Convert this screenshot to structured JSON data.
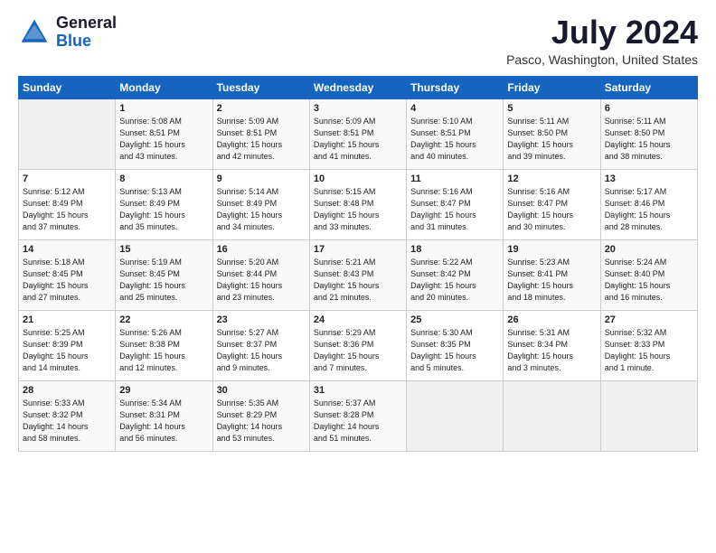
{
  "header": {
    "logo_general": "General",
    "logo_blue": "Blue",
    "month_year": "July 2024",
    "location": "Pasco, Washington, United States"
  },
  "days_of_week": [
    "Sunday",
    "Monday",
    "Tuesday",
    "Wednesday",
    "Thursday",
    "Friday",
    "Saturday"
  ],
  "weeks": [
    [
      {
        "day": "",
        "info": ""
      },
      {
        "day": "1",
        "info": "Sunrise: 5:08 AM\nSunset: 8:51 PM\nDaylight: 15 hours\nand 43 minutes."
      },
      {
        "day": "2",
        "info": "Sunrise: 5:09 AM\nSunset: 8:51 PM\nDaylight: 15 hours\nand 42 minutes."
      },
      {
        "day": "3",
        "info": "Sunrise: 5:09 AM\nSunset: 8:51 PM\nDaylight: 15 hours\nand 41 minutes."
      },
      {
        "day": "4",
        "info": "Sunrise: 5:10 AM\nSunset: 8:51 PM\nDaylight: 15 hours\nand 40 minutes."
      },
      {
        "day": "5",
        "info": "Sunrise: 5:11 AM\nSunset: 8:50 PM\nDaylight: 15 hours\nand 39 minutes."
      },
      {
        "day": "6",
        "info": "Sunrise: 5:11 AM\nSunset: 8:50 PM\nDaylight: 15 hours\nand 38 minutes."
      }
    ],
    [
      {
        "day": "7",
        "info": "Sunrise: 5:12 AM\nSunset: 8:49 PM\nDaylight: 15 hours\nand 37 minutes."
      },
      {
        "day": "8",
        "info": "Sunrise: 5:13 AM\nSunset: 8:49 PM\nDaylight: 15 hours\nand 35 minutes."
      },
      {
        "day": "9",
        "info": "Sunrise: 5:14 AM\nSunset: 8:49 PM\nDaylight: 15 hours\nand 34 minutes."
      },
      {
        "day": "10",
        "info": "Sunrise: 5:15 AM\nSunset: 8:48 PM\nDaylight: 15 hours\nand 33 minutes."
      },
      {
        "day": "11",
        "info": "Sunrise: 5:16 AM\nSunset: 8:47 PM\nDaylight: 15 hours\nand 31 minutes."
      },
      {
        "day": "12",
        "info": "Sunrise: 5:16 AM\nSunset: 8:47 PM\nDaylight: 15 hours\nand 30 minutes."
      },
      {
        "day": "13",
        "info": "Sunrise: 5:17 AM\nSunset: 8:46 PM\nDaylight: 15 hours\nand 28 minutes."
      }
    ],
    [
      {
        "day": "14",
        "info": "Sunrise: 5:18 AM\nSunset: 8:45 PM\nDaylight: 15 hours\nand 27 minutes."
      },
      {
        "day": "15",
        "info": "Sunrise: 5:19 AM\nSunset: 8:45 PM\nDaylight: 15 hours\nand 25 minutes."
      },
      {
        "day": "16",
        "info": "Sunrise: 5:20 AM\nSunset: 8:44 PM\nDaylight: 15 hours\nand 23 minutes."
      },
      {
        "day": "17",
        "info": "Sunrise: 5:21 AM\nSunset: 8:43 PM\nDaylight: 15 hours\nand 21 minutes."
      },
      {
        "day": "18",
        "info": "Sunrise: 5:22 AM\nSunset: 8:42 PM\nDaylight: 15 hours\nand 20 minutes."
      },
      {
        "day": "19",
        "info": "Sunrise: 5:23 AM\nSunset: 8:41 PM\nDaylight: 15 hours\nand 18 minutes."
      },
      {
        "day": "20",
        "info": "Sunrise: 5:24 AM\nSunset: 8:40 PM\nDaylight: 15 hours\nand 16 minutes."
      }
    ],
    [
      {
        "day": "21",
        "info": "Sunrise: 5:25 AM\nSunset: 8:39 PM\nDaylight: 15 hours\nand 14 minutes."
      },
      {
        "day": "22",
        "info": "Sunrise: 5:26 AM\nSunset: 8:38 PM\nDaylight: 15 hours\nand 12 minutes."
      },
      {
        "day": "23",
        "info": "Sunrise: 5:27 AM\nSunset: 8:37 PM\nDaylight: 15 hours\nand 9 minutes."
      },
      {
        "day": "24",
        "info": "Sunrise: 5:29 AM\nSunset: 8:36 PM\nDaylight: 15 hours\nand 7 minutes."
      },
      {
        "day": "25",
        "info": "Sunrise: 5:30 AM\nSunset: 8:35 PM\nDaylight: 15 hours\nand 5 minutes."
      },
      {
        "day": "26",
        "info": "Sunrise: 5:31 AM\nSunset: 8:34 PM\nDaylight: 15 hours\nand 3 minutes."
      },
      {
        "day": "27",
        "info": "Sunrise: 5:32 AM\nSunset: 8:33 PM\nDaylight: 15 hours\nand 1 minute."
      }
    ],
    [
      {
        "day": "28",
        "info": "Sunrise: 5:33 AM\nSunset: 8:32 PM\nDaylight: 14 hours\nand 58 minutes."
      },
      {
        "day": "29",
        "info": "Sunrise: 5:34 AM\nSunset: 8:31 PM\nDaylight: 14 hours\nand 56 minutes."
      },
      {
        "day": "30",
        "info": "Sunrise: 5:35 AM\nSunset: 8:29 PM\nDaylight: 14 hours\nand 53 minutes."
      },
      {
        "day": "31",
        "info": "Sunrise: 5:37 AM\nSunset: 8:28 PM\nDaylight: 14 hours\nand 51 minutes."
      },
      {
        "day": "",
        "info": ""
      },
      {
        "day": "",
        "info": ""
      },
      {
        "day": "",
        "info": ""
      }
    ]
  ]
}
